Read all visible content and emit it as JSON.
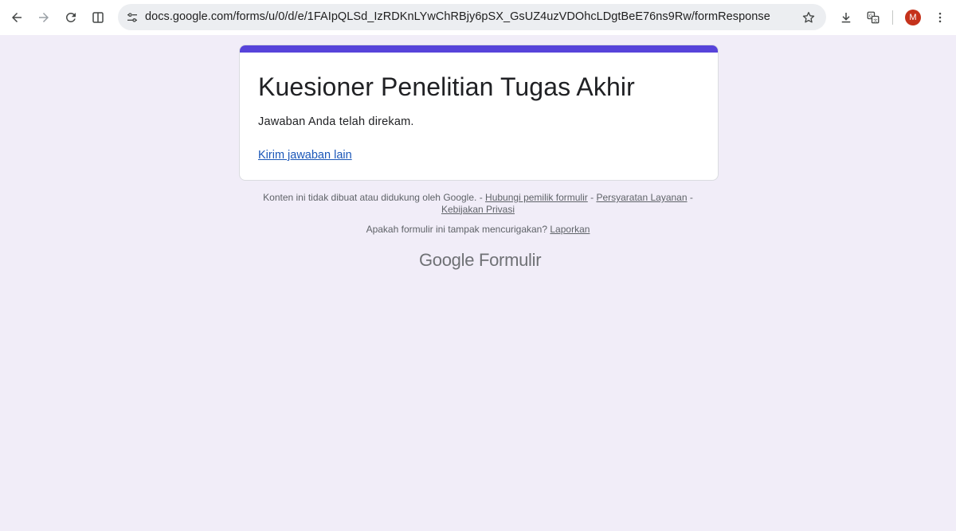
{
  "browser": {
    "url": "docs.google.com/forms/u/0/d/e/1FAIpQLSd_IzRDKnLYwChRBjy6pSX_GsUZ4uzVDOhcLDgtBeE76ns9Rw/formResponse",
    "profile_initial": "M",
    "icons": {
      "back": "arrow-left-icon",
      "forward": "arrow-right-icon",
      "reload": "reload-icon",
      "split": "split-view-icon",
      "site_info": "tune-icon",
      "bookmark": "star-icon",
      "download": "download-icon",
      "translate": "translate-icon",
      "menu": "more-vert-icon"
    },
    "colors": {
      "avatar": "#c5321b"
    }
  },
  "form": {
    "title": "Kuesioner Penelitian Tugas Akhir",
    "confirmation": "Jawaban Anda telah direkam.",
    "submit_another": "Kirim jawaban lain",
    "accent_color": "#5743da",
    "page_background": "#f1edf8"
  },
  "footer": {
    "disclaimer": "Konten ini tidak dibuat atau didukung oleh Google.",
    "sep": "-",
    "contact_owner": "Hubungi pemilik formulir",
    "terms": "Persyaratan Layanan",
    "privacy": "Kebijakan Privasi",
    "suspicious": "Apakah formulir ini tampak mencurigakan?",
    "report": "Laporkan",
    "brand_google": "Google",
    "brand_forms": "Formulir"
  }
}
